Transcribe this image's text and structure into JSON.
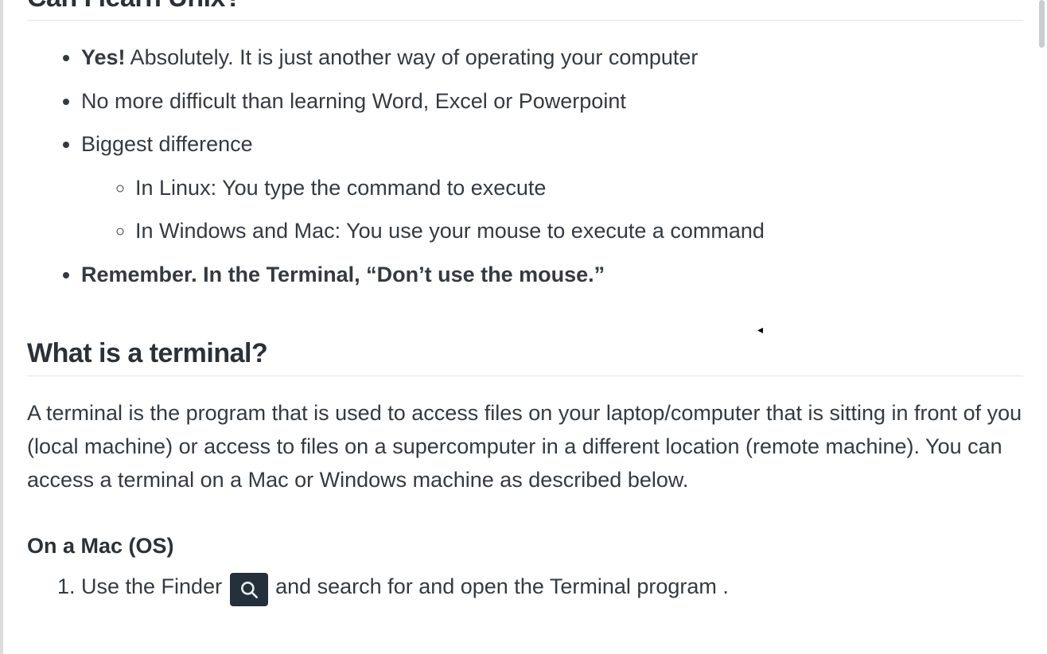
{
  "section1": {
    "title": "Can I learn Unix?",
    "bullets": {
      "b1_bold": "Yes!",
      "b1_rest": " Absolutely. It is just another way of operating your computer",
      "b2": "No more difficult than learning Word, Excel or Powerpoint",
      "b3": "Biggest difference",
      "b3_sub1": "In Linux: You type the command to execute",
      "b3_sub2": "In Windows and Mac: You use your mouse to execute a command",
      "b4_bold": "Remember. In the Terminal, “Don’t use the mouse.”"
    }
  },
  "section2": {
    "title": "What is a terminal?",
    "paragraph": "A terminal is the program that is used to access files on your laptop/computer that is sitting in front of you (local machine) or access to files on a supercomputer in a different location (remote machine). You can access a terminal on a Mac or Windows machine as described below."
  },
  "section3": {
    "title": "On a Mac (OS)",
    "step1_pre": "Use the Finder ",
    "step1_post": " and search for and open the Terminal program ."
  },
  "icons": {
    "spotlight": "search-icon"
  }
}
